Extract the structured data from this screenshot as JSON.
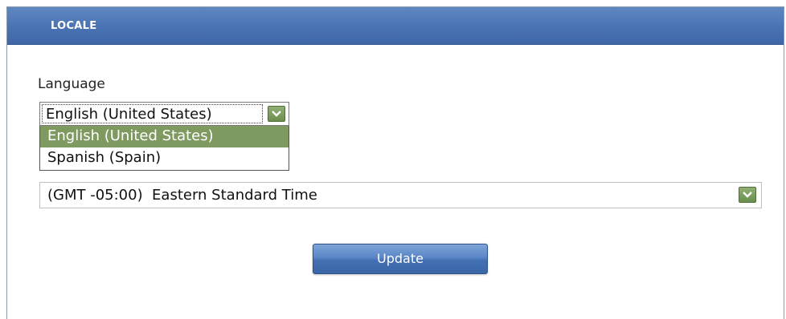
{
  "panel": {
    "title": "LOCALE"
  },
  "language": {
    "label": "Language",
    "selected": "English (United States)",
    "options": [
      "English (United States)",
      "Spanish (Spain)"
    ],
    "dropdown_open": true
  },
  "timezone": {
    "selected": "(GMT -05:00)  Eastern Standard Time"
  },
  "actions": {
    "update_label": "Update"
  },
  "icons": {
    "dropdown_arrow": "chevron-down-icon"
  },
  "colors": {
    "header_blue": "#4a73b3",
    "selected_option_green": "#7f9a61",
    "arrow_button_green": "#7a9c5e",
    "button_blue": "#4d7bbd"
  }
}
